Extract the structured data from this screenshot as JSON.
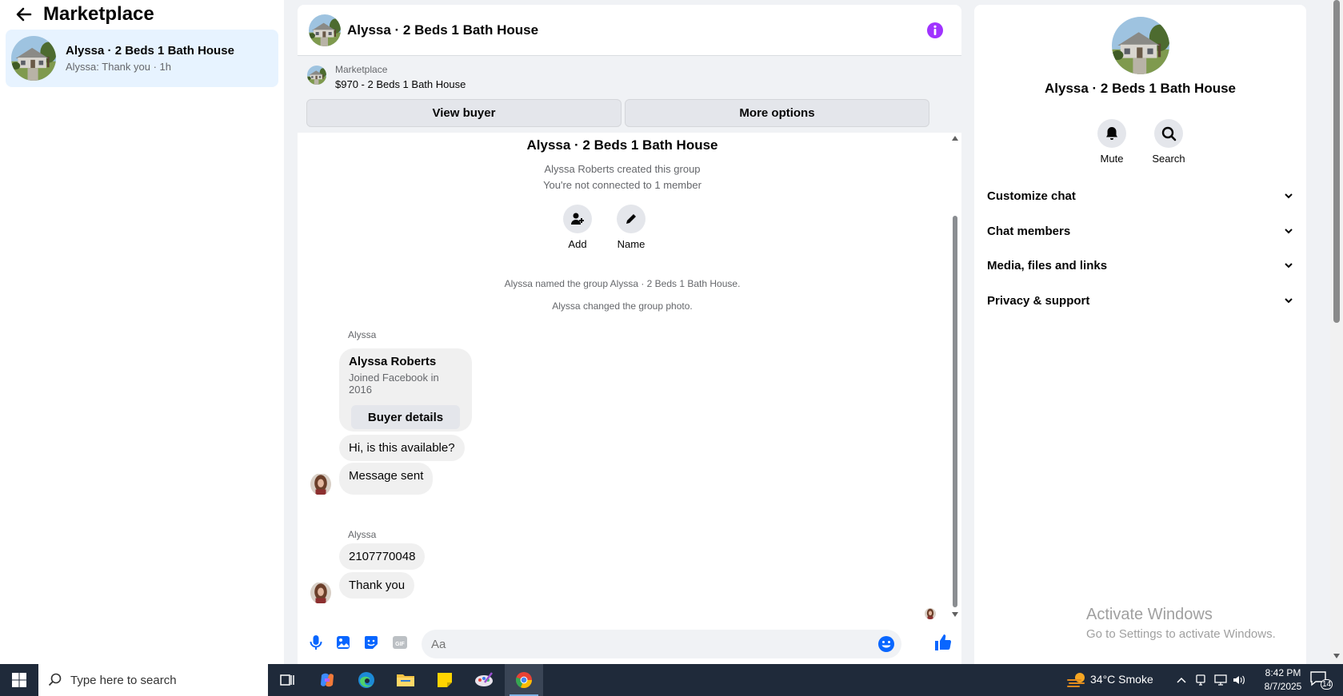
{
  "sidebar": {
    "title": "Marketplace",
    "conversation": {
      "title": "Alyssa · 2 Beds 1 Bath House",
      "subtitle": "Alyssa: Thank you · 1h"
    }
  },
  "chat": {
    "title": "Alyssa · 2 Beds 1 Bath House",
    "listing": {
      "label": "Marketplace",
      "price_title": "$970 - 2 Beds 1 Bath House",
      "view_buyer": "View buyer",
      "more_options": "More options"
    },
    "group": {
      "title": "Alyssa · 2 Beds 1 Bath House",
      "created": "Alyssa Roberts created this group",
      "not_connected": "You're not connected to 1 member",
      "add_label": "Add",
      "name_label": "Name"
    },
    "system": [
      "Alyssa named the group Alyssa · 2 Beds 1 Bath House.",
      "Alyssa changed the group photo."
    ],
    "messages": {
      "sender1": "Alyssa",
      "card_name": "Alyssa Roberts",
      "card_sub": "Joined Facebook in 2016",
      "card_button": "Buyer details",
      "msg1": "Hi, is this available?",
      "msg2": "Message sent",
      "sender2": "Alyssa",
      "msg3": "2107770048",
      "msg4": "Thank you"
    },
    "composer_placeholder": "Aa"
  },
  "details": {
    "title": "Alyssa · 2 Beds 1 Bath House",
    "mute_label": "Mute",
    "search_label": "Search",
    "sections": [
      "Customize chat",
      "Chat members",
      "Media, files and links",
      "Privacy & support"
    ]
  },
  "watermark": {
    "line1": "Activate Windows",
    "line2": "Go to Settings to activate Windows."
  },
  "taskbar": {
    "search_placeholder": "Type here to search",
    "weather": "34°C  Smoke",
    "time": "8:42 PM",
    "date": "8/7/2025",
    "notifications": "14"
  },
  "colors": {
    "accent": "#0866ff",
    "info_purple": "#a033ff",
    "selected_bg": "#e7f3ff"
  }
}
